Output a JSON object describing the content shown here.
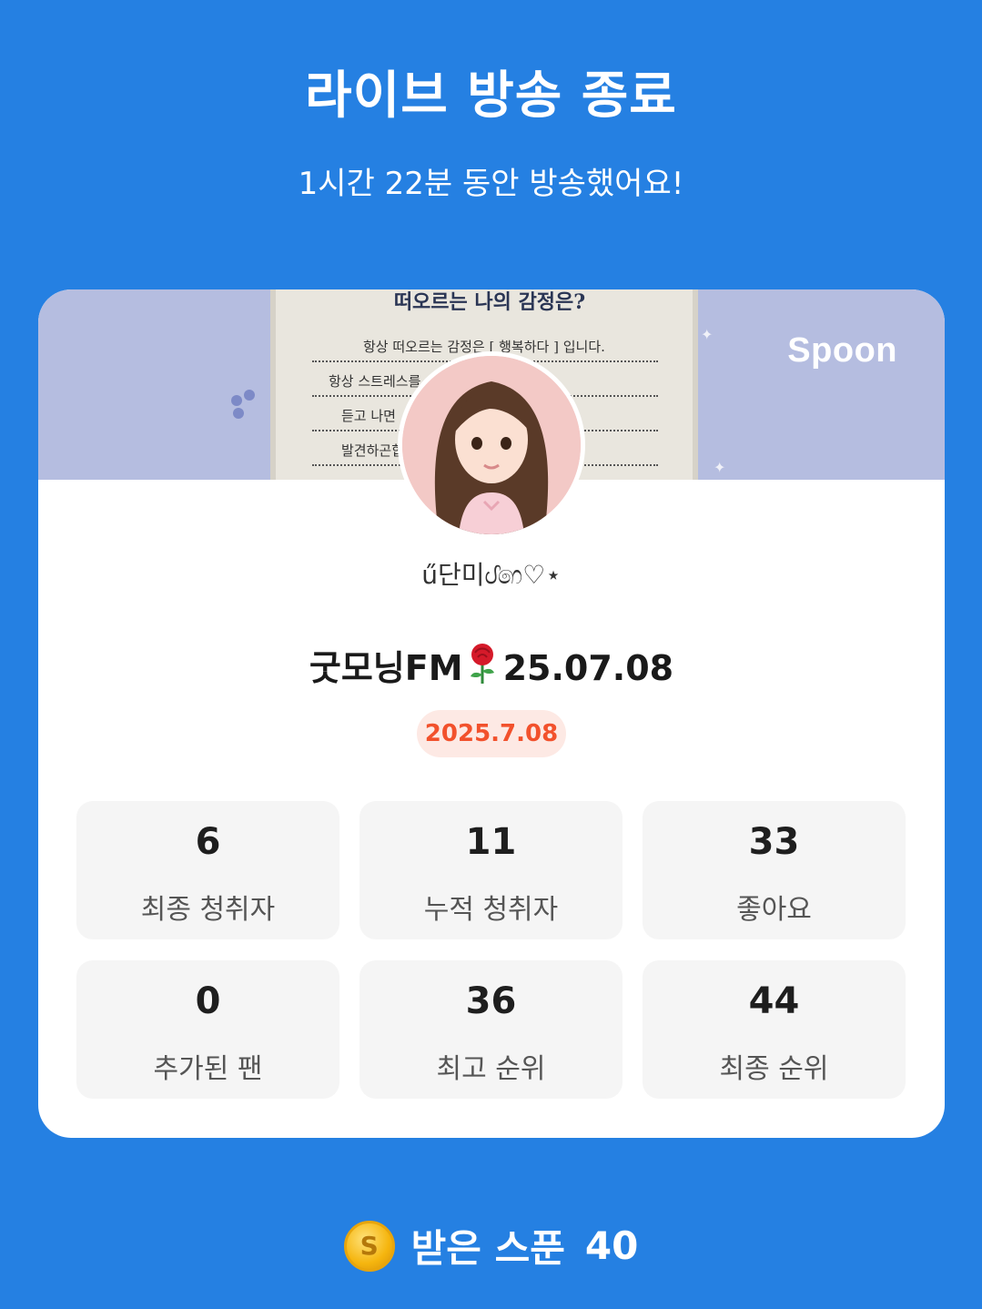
{
  "header": {
    "title": "라이브 방송 종료",
    "subtitle": "1시간 22분 동안 방송했어요!"
  },
  "card": {
    "brand": "Spoon",
    "banner_heading": "떠오르는 나의 감정은?",
    "banner_lines": [
      "항상 떠오르는 감정은 [ 행복하다 ] 입니다.",
      "항상 스트레스를 ...이의 방송을",
      "듣고 나면 ...내모습을",
      "발견하곤합...스트레스는"
    ],
    "nickname": "ű단미ᦔ෨♡⋆",
    "room_title": "굿모닝FM",
    "room_date": "25.07.08",
    "date_badge": "2025.7.08",
    "stats": [
      {
        "value": "6",
        "label": "최종 청취자"
      },
      {
        "value": "11",
        "label": "누적 청취자"
      },
      {
        "value": "33",
        "label": "좋아요"
      },
      {
        "value": "0",
        "label": "추가된 팬"
      },
      {
        "value": "36",
        "label": "최고 순위"
      },
      {
        "value": "44",
        "label": "최종 순위"
      }
    ]
  },
  "footer": {
    "coin_symbol": "S",
    "spoons_label": "받은 스푼",
    "spoons_count": "40"
  },
  "colors": {
    "background": "#2580e2",
    "banner": "#b5bde0",
    "badge_text": "#f2512c",
    "badge_bg": "#fde9e4"
  }
}
